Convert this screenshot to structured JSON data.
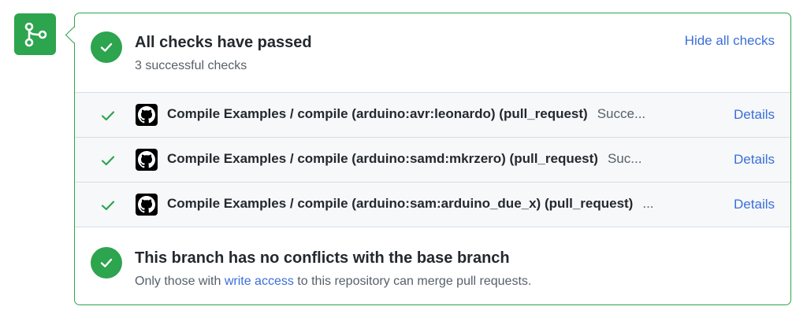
{
  "colors": {
    "success": "#2da44e",
    "link": "#3a6fd8",
    "muted": "#57606a"
  },
  "icons": {
    "merge_icon": "git-merge-icon",
    "status_icon": "check-circle-icon",
    "check_icon": "check-icon",
    "app_icon": "github-logo-icon"
  },
  "checks_summary": {
    "title": "All checks have passed",
    "subtitle": "3 successful checks",
    "hide_label": "Hide all checks"
  },
  "checks": [
    {
      "name": "Compile Examples / compile (arduino:avr:leonardo) (pull_request)",
      "status": "Succe...",
      "details_label": "Details"
    },
    {
      "name": "Compile Examples / compile (arduino:samd:mkrzero) (pull_request)",
      "status": "Suc...",
      "details_label": "Details"
    },
    {
      "name": "Compile Examples / compile (arduino:sam:arduino_due_x) (pull_request)",
      "status": "...",
      "details_label": "Details"
    }
  ],
  "merge_status": {
    "title": "This branch has no conflicts with the base branch",
    "message_before": "Only those with ",
    "message_link": "write access",
    "message_after": " to this repository can merge pull requests."
  }
}
